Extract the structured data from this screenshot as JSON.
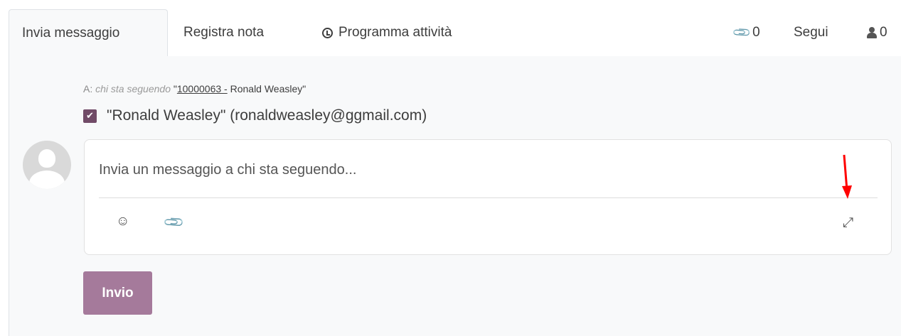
{
  "tabs": [
    {
      "label": "Invia messaggio",
      "active": true
    },
    {
      "label": "Registra nota",
      "active": false
    },
    {
      "label": "Programma attività",
      "icon": "clock-icon",
      "active": false
    }
  ],
  "topbar_right": {
    "attachments_count": "0",
    "follow_label": "Segui",
    "followers_count": "0"
  },
  "composer": {
    "recipients_prefix": "A:",
    "recipients_italic": "chi sta seguendo",
    "record_quote_open": "\"",
    "record_id": "10000063 -",
    "record_name": "Ronald Weasley\"",
    "follower_label": "\"Ronald Weasley\" (ronaldweasley@ggmail.com)",
    "follower_checked": true,
    "placeholder": "Invia un messaggio a chi sta seguendo...",
    "send_label": "Invio"
  },
  "colors": {
    "brand": "#714b67",
    "send_button": "#a57a9b",
    "annotation_arrow": "#ff0000"
  }
}
